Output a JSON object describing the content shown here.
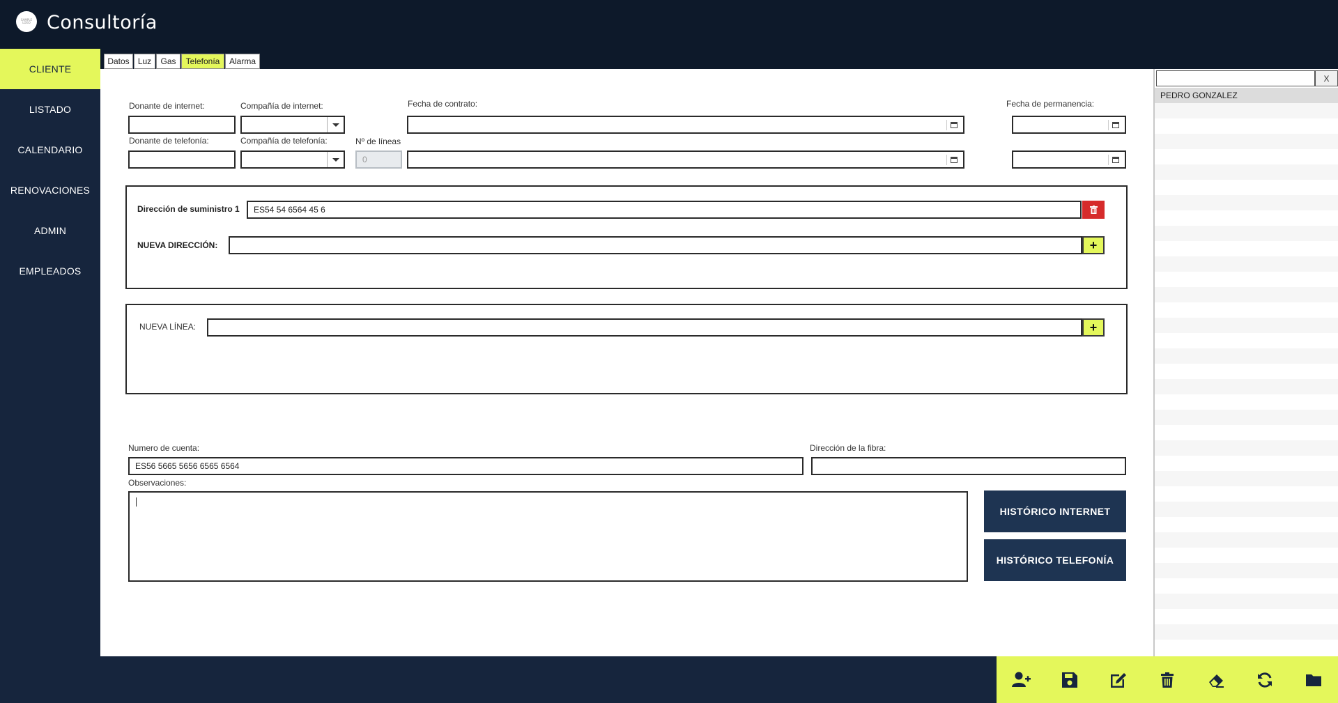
{
  "app": {
    "title": "Consultoría",
    "logo_text_1": "SAMPLE",
    "logo_text_2": "LOGO"
  },
  "sidebar": {
    "items": [
      {
        "label": "CLIENTE",
        "active": true
      },
      {
        "label": "LISTADO"
      },
      {
        "label": "CALENDARIO"
      },
      {
        "label": "RENOVACIONES"
      },
      {
        "label": "ADMIN"
      },
      {
        "label": "EMPLEADOS"
      }
    ]
  },
  "tabs": [
    {
      "label": "Datos"
    },
    {
      "label": "Luz"
    },
    {
      "label": "Gas"
    },
    {
      "label": "Telefonía",
      "active": true
    },
    {
      "label": "Alarma"
    }
  ],
  "form": {
    "donante_internet_label": "Donante de internet:",
    "compania_internet_label": "Compañía de internet:",
    "fecha_contrato_label": "Fecha de contrato:",
    "fecha_permanencia_label": "Fecha de permanencia:",
    "donante_telefonia_label": "Donante de telefonía:",
    "compania_telefonia_label": "Compañía de telefonía:",
    "num_lineas_label": "Nº de líneas",
    "num_lineas_value": "0",
    "direccion_suministro_label": "Dirección de suministro 1",
    "direccion_suministro_value": "ES54 54 6564 45 6",
    "nueva_direccion_label": "NUEVA DIRECCIÓN:",
    "nueva_linea_label": "NUEVA LÍNEA:",
    "numero_cuenta_label": "Numero de cuenta:",
    "numero_cuenta_value": "ES56 5665 5656 6565 6564",
    "direccion_fibra_label": "Dirección de la fibra:",
    "observaciones_label": "Observaciones:",
    "historico_internet": "HISTÓRICO INTERNET",
    "historico_telefonia": "HISTÓRICO TELEFONÍA"
  },
  "client_list": {
    "search_value": "",
    "clear_label": "X",
    "items": [
      "PEDRO GONZALEZ"
    ]
  },
  "toolbar": {
    "buttons": [
      "add-user-icon",
      "save-icon",
      "edit-icon",
      "trash-icon",
      "eraser-icon",
      "refresh-icon",
      "folder-icon"
    ]
  },
  "colors": {
    "accent": "#e4f75b",
    "navy": "#16253d",
    "header": "#0d192a",
    "button": "#1e3452",
    "danger": "#d62b2b"
  }
}
